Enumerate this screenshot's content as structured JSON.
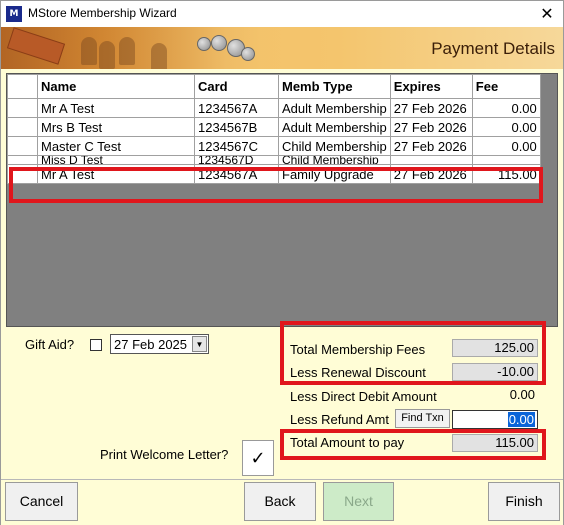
{
  "window": {
    "title": "MStore Membership Wizard",
    "icon": "app-icon",
    "close_glyph": "✕"
  },
  "banner": {
    "title": "Payment Details"
  },
  "grid": {
    "headers": [
      "",
      "Name",
      "Card",
      "Memb Type",
      "Expires",
      "Fee"
    ],
    "rows": [
      {
        "name": "Mr A Test",
        "card": "1234567A",
        "type": "Adult Membership",
        "expires": "27 Feb 2026",
        "fee": "0.00"
      },
      {
        "name": "Mrs B Test",
        "card": "1234567B",
        "type": "Adult Membership",
        "expires": "27 Feb 2026",
        "fee": "0.00"
      },
      {
        "name": "Master C Test",
        "card": "1234567C",
        "type": "Child Membership",
        "expires": "27 Feb 2026",
        "fee": "0.00"
      },
      {
        "name": "Miss D Test",
        "card": "1234567D",
        "type": "Child Membership",
        "expires": "",
        "fee": ""
      },
      {
        "name": "Mr A Test",
        "card": "1234567A",
        "type": "Family Upgrade",
        "expires": "27 Feb 2026",
        "fee": "115.00"
      }
    ]
  },
  "gift_aid": {
    "label": "Gift Aid?",
    "checked": false,
    "date_value": "27 Feb 2025"
  },
  "summary": {
    "total_fees_label": "Total Membership Fees",
    "total_fees_value": "125.00",
    "renewal_discount_label": "Less Renewal Discount",
    "renewal_discount_value": "-10.00",
    "direct_debit_label": "Less Direct Debit Amount",
    "direct_debit_value": "0.00",
    "refund_label": "Less Refund Amt",
    "find_txn_label": "Find Txn",
    "refund_value": "0.00",
    "total_pay_label": "Total Amount to pay",
    "total_pay_value": "115.00"
  },
  "print": {
    "label": "Print Welcome Letter?",
    "checked": true,
    "check_glyph": "✓"
  },
  "buttons": {
    "cancel": "Cancel",
    "back": "Back",
    "next": "Next",
    "finish": "Finish"
  },
  "colors": {
    "highlight": "#e0161c",
    "background": "#fffdd6",
    "selection": "#0a64d8"
  }
}
